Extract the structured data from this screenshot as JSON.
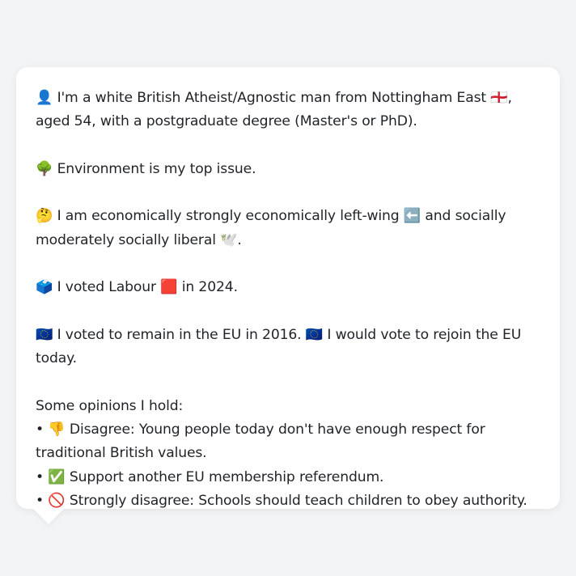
{
  "profile": {
    "intro": "👤 I'm a white British Atheist/Agnostic man from Nottingham East 🏴󠁧󠁢󠁥󠁮󠁧󠁿, aged 54, with a postgraduate degree (Master's or PhD).",
    "top_issue": "🌳 Environment is my top issue.",
    "ideology": "🤔 I am economically strongly economically left-wing ⬅️ and socially moderately socially liberal 🕊️.",
    "vote_2024": "🗳️ I voted Labour 🟥 in 2024.",
    "eu": "🇪🇺 I voted to remain in the EU in 2016. 🇪🇺 I would vote to rejoin the EU today.",
    "opinions_heading": "Some opinions I hold:",
    "opinions": [
      "• 👎 Disagree: Young people today don't have enough respect for traditional British values.",
      "• ✅ Support another EU membership referendum.",
      "• 🚫 Strongly disagree: Schools should teach children to obey authority."
    ]
  }
}
